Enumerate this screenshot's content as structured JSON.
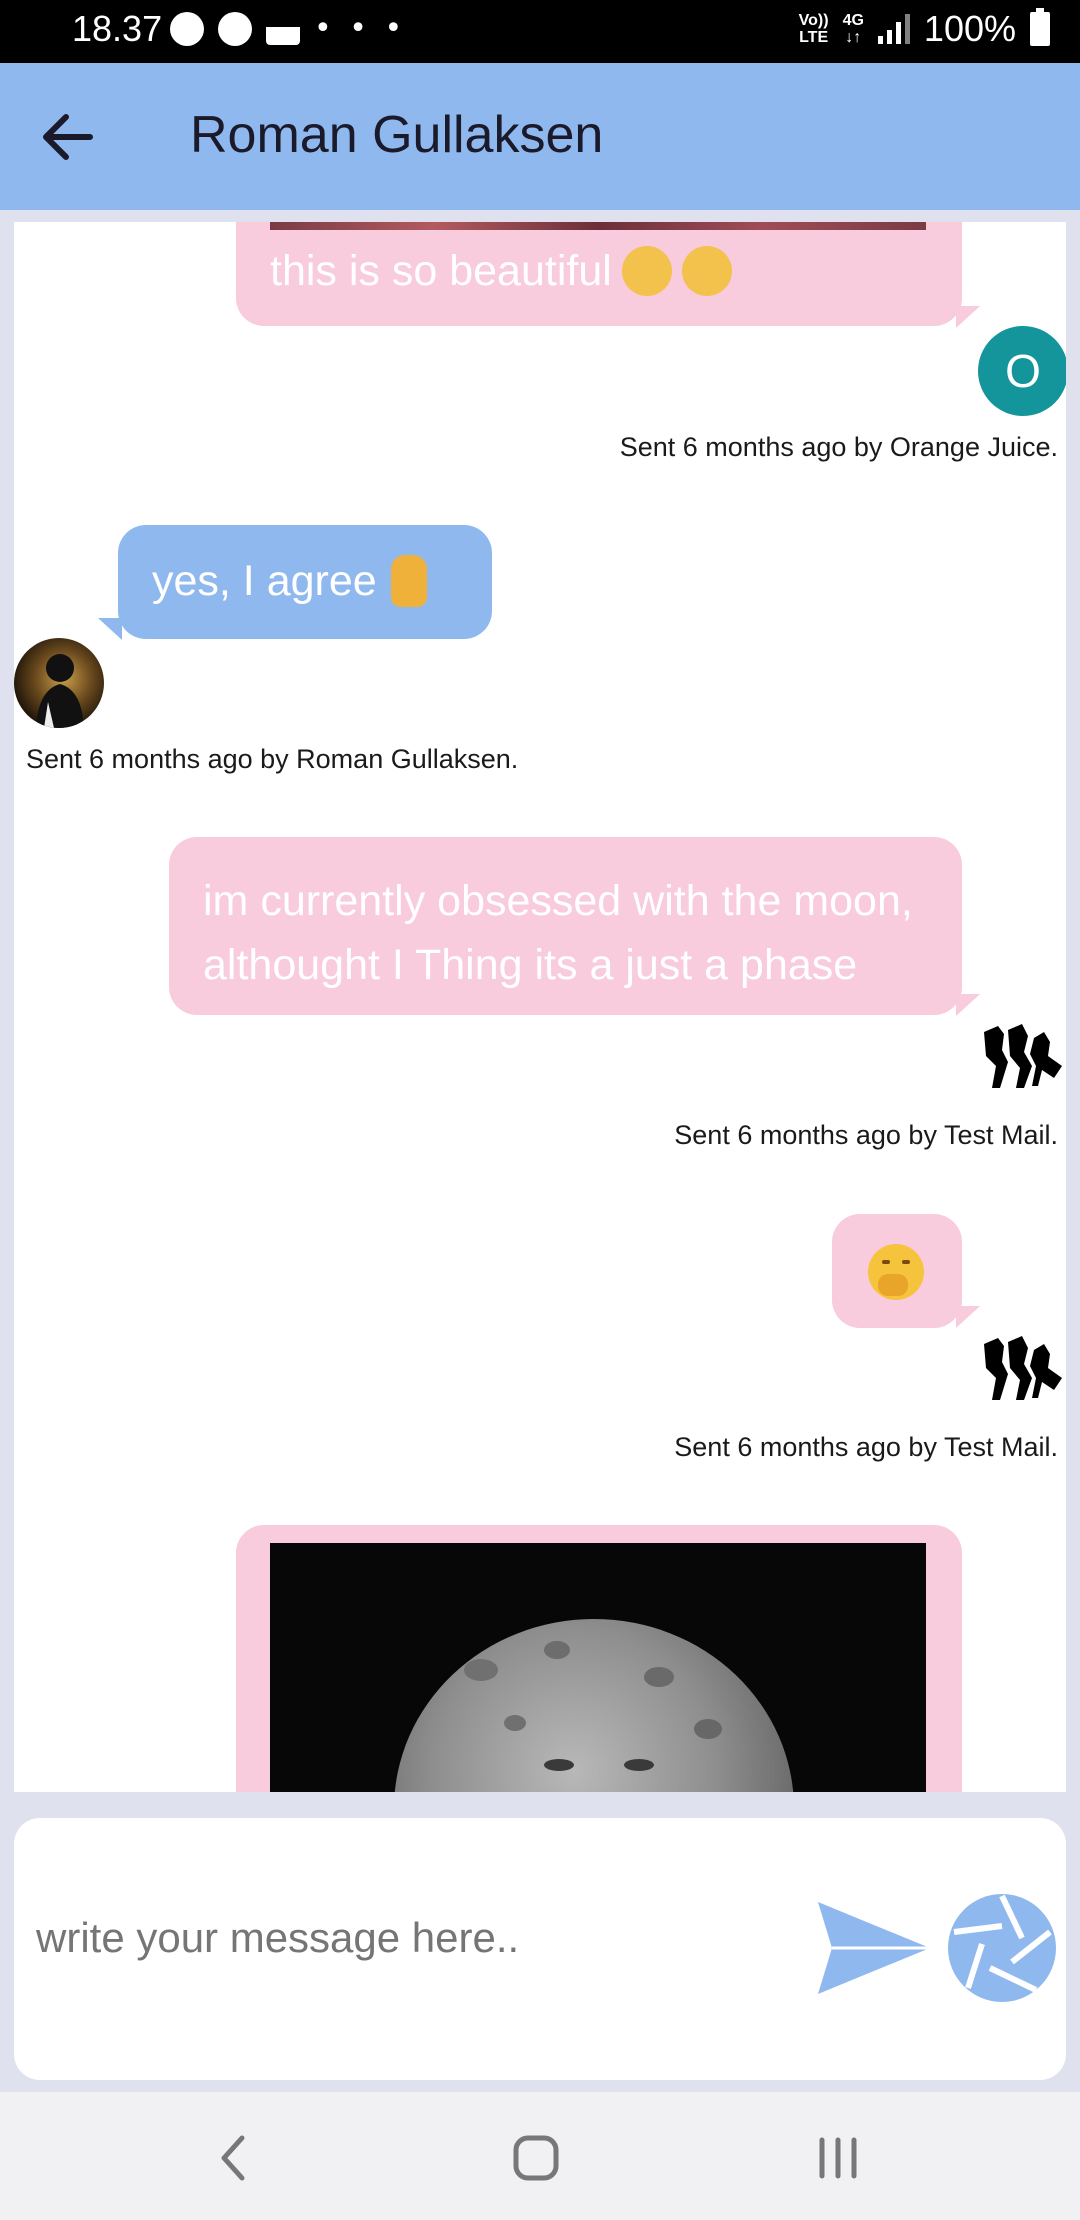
{
  "status_bar": {
    "time": "18.37",
    "dots": "• • •",
    "network_top": "Vo))",
    "network_bottom": "LTE",
    "gen_top": "4G",
    "gen_bottom": "↓↑",
    "battery": "100%"
  },
  "header": {
    "title": "Roman Gullaksen"
  },
  "messages": [
    {
      "text": "this is so beautiful",
      "meta": "Sent 6 months ago by Orange Juice.",
      "avatar_letter": "O"
    },
    {
      "text": "yes, I agree",
      "meta": "Sent 6 months ago by Roman Gullaksen."
    },
    {
      "text_line1": "im currently obsessed with the moon,",
      "text_line2": "althought I Thing its a just a phase",
      "meta": "Sent 6 months ago by Test Mail."
    },
    {
      "emoji": "face-with-hand-over-mouth",
      "meta": "Sent 6 months ago by Test Mail."
    },
    {
      "image": "moon-face-photo"
    }
  ],
  "composer": {
    "placeholder": "write your message here.."
  },
  "icons": {
    "back": "arrow-left-icon",
    "send": "send-icon",
    "camera": "camera-shutter-icon",
    "nav_back": "nav-back-icon",
    "nav_home": "nav-home-icon",
    "nav_recents": "nav-recents-icon"
  },
  "colors": {
    "header": "#8fb9ee",
    "pink_bubble": "#f8cbdd",
    "blue_bubble": "#8fb9ee",
    "avatar_teal": "#13959b",
    "background": "#dfe2ee"
  }
}
